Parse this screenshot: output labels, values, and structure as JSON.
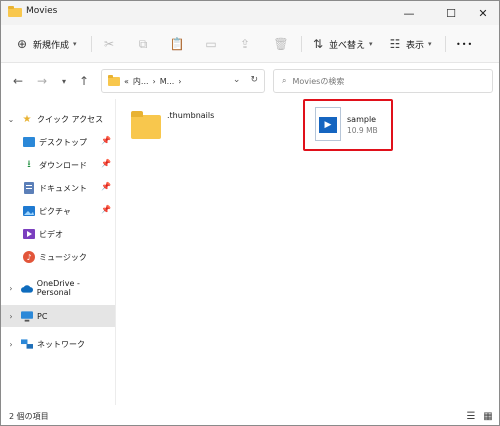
{
  "window": {
    "title": "Movies"
  },
  "titlebar": {
    "minimize_glyph": "—",
    "maximize_glyph": "☐",
    "close_glyph": "✕"
  },
  "commandbar": {
    "new_label": "新規作成",
    "sort_label": "並べ替え",
    "view_label": "表示",
    "more_glyph": "•••"
  },
  "address": {
    "path_prefix": "«",
    "segments": [
      "内...",
      "M..."
    ],
    "separator": "›"
  },
  "search": {
    "placeholder": "Moviesの検索"
  },
  "sidebar": {
    "items": [
      {
        "label": "クイック アクセス",
        "icon": "star-icon"
      },
      {
        "label": "デスクトップ",
        "icon": "desktop-icon"
      },
      {
        "label": "ダウンロード",
        "icon": "download-icon"
      },
      {
        "label": "ドキュメント",
        "icon": "document-icon"
      },
      {
        "label": "ピクチャ",
        "icon": "pictures-icon"
      },
      {
        "label": "ビデオ",
        "icon": "video-icon"
      },
      {
        "label": "ミュージック",
        "icon": "music-icon"
      },
      {
        "label": "OneDrive - Personal",
        "icon": "cloud-icon"
      },
      {
        "label": "PC",
        "icon": "pc-icon"
      },
      {
        "label": "ネットワーク",
        "icon": "network-icon"
      }
    ]
  },
  "content": {
    "items": [
      {
        "name": ".thumbnails",
        "type": "folder"
      },
      {
        "name": "sample",
        "size": "10.9 MB",
        "type": "video"
      }
    ]
  },
  "status": {
    "count_text": "2 個の項目"
  },
  "colors": {
    "highlight": "#e0101a",
    "folder": "#f8c74d",
    "accent": "#1565c0"
  }
}
